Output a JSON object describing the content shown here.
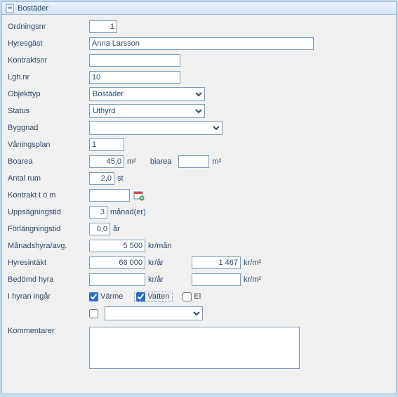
{
  "title": "Bostäder",
  "labels": {
    "ordningsnr": "Ordningsnr",
    "hyresgast": "Hyresgäst",
    "kontraktsnr": "Kontraktsnr",
    "lghnr": "Lgh.nr",
    "objekttyp": "Objekttyp",
    "status": "Status",
    "byggnad": "Byggnad",
    "vaningsplan": "Våningsplan",
    "boarea": "Boarea",
    "biarea": "biarea",
    "antal_rum": "Antal rum",
    "kontrakt_tom": "Kontrakt t o m",
    "uppsagningstid": "Uppsägningstid",
    "forlangningstid": "Förlängningstid",
    "manadshyra": "Månadshyra/avg.",
    "hyresintakt": "Hyresintäkt",
    "bedomd_hyra": "Bedömd hyra",
    "i_hyran_ingar": "I hyran ingår",
    "kommentarer": "Kommentarer"
  },
  "units": {
    "m2": "m²",
    "st": "st",
    "manader": "månad(er)",
    "ar": "år",
    "kr_man": "kr/mån",
    "kr_ar": "kr/år",
    "kr_m2": "kr/m²"
  },
  "values": {
    "ordningsnr": "1",
    "hyresgast": "Anna Larsson",
    "kontraktsnr": "",
    "lghnr": "10",
    "objekttyp": "Bostäder",
    "status": "Uthyrd",
    "byggnad": "",
    "vaningsplan": "1",
    "boarea": "45,0",
    "biarea": "",
    "antal_rum": "2,0",
    "kontrakt_tom": "",
    "uppsagningstid": "3",
    "forlangningstid": "0,0",
    "manadshyra": "5 500",
    "hyresintakt_ar": "66 000",
    "hyresintakt_m2": "1 467",
    "bedomd_ar": "",
    "bedomd_m2": "",
    "kommentarer": ""
  },
  "checks": {
    "varme": "Värme",
    "vatten": "Vatten",
    "el": "El"
  },
  "checks_state": {
    "varme": true,
    "vatten": true,
    "el": false,
    "extra": false
  }
}
